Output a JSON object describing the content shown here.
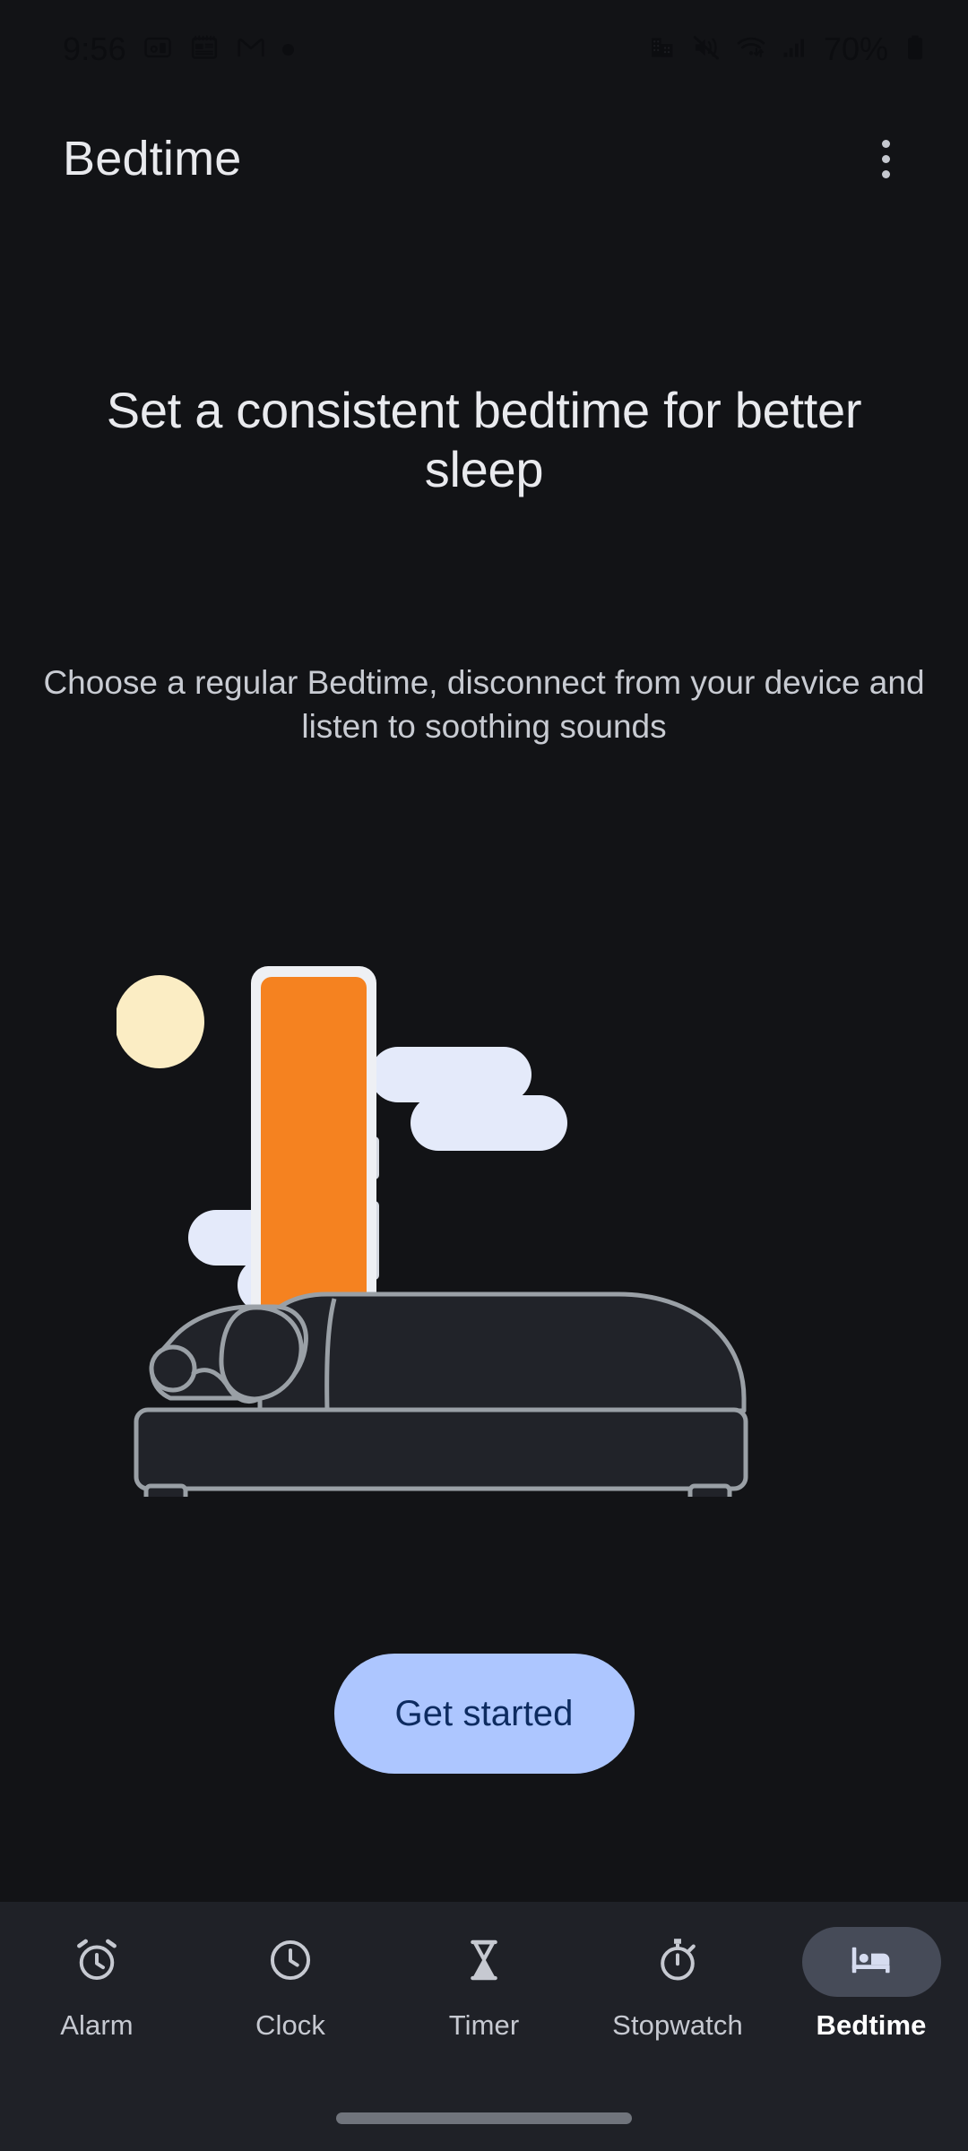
{
  "status_bar": {
    "clock": "9:56",
    "battery_percent": "70%",
    "left_icons": [
      "clock-text",
      "keep-note-icon",
      "calendar-icon",
      "gmail-icon",
      "notification-dot-icon"
    ],
    "right_icons": [
      "work-profile-icon",
      "vibrate-mute-icon",
      "wifi-icon",
      "cellular-signal-icon",
      "battery-icon"
    ]
  },
  "app_bar": {
    "title": "Bedtime",
    "overflow_icon": "more-vert-icon"
  },
  "hero": {
    "headline": "Set a consistent bedtime for better sleep",
    "subhead": "Choose a regular Bedtime, disconnect from your device and listen to soothing sounds"
  },
  "illustration": {
    "name": "person-sleeping-in-bed-with-phone",
    "elements": [
      "moon",
      "cloud-left",
      "cloud-right",
      "phone",
      "person",
      "bed",
      "floor-line"
    ],
    "colors": {
      "moon": "#fbedc4",
      "cloud": "#e4eafa",
      "phone_frame": "#eef0f4",
      "phone_screen": "#f58220",
      "outline": "#9aa0a6",
      "fill": "#212329",
      "floor": "#8f949c"
    }
  },
  "cta": {
    "label": "Get started",
    "background": "#adc6ff",
    "text_color": "#0d2b60"
  },
  "bottom_nav": {
    "items": [
      {
        "label": "Alarm",
        "icon": "alarm-icon",
        "selected": false
      },
      {
        "label": "Clock",
        "icon": "clock-icon",
        "selected": false
      },
      {
        "label": "Timer",
        "icon": "hourglass-icon",
        "selected": false
      },
      {
        "label": "Stopwatch",
        "icon": "stopwatch-icon",
        "selected": false
      },
      {
        "label": "Bedtime",
        "icon": "bed-icon",
        "selected": true
      }
    ],
    "selected_index": 4,
    "selected_pill_color": "#464b58"
  },
  "gesture_bar": {
    "name": "home-gesture-bar",
    "color": "#70747c"
  },
  "theme": {
    "background": "#121316",
    "nav_background": "#1f2127",
    "primary_text": "#e9eaee",
    "secondary_text": "#c8cbd2",
    "accent": "#adc6ff"
  }
}
